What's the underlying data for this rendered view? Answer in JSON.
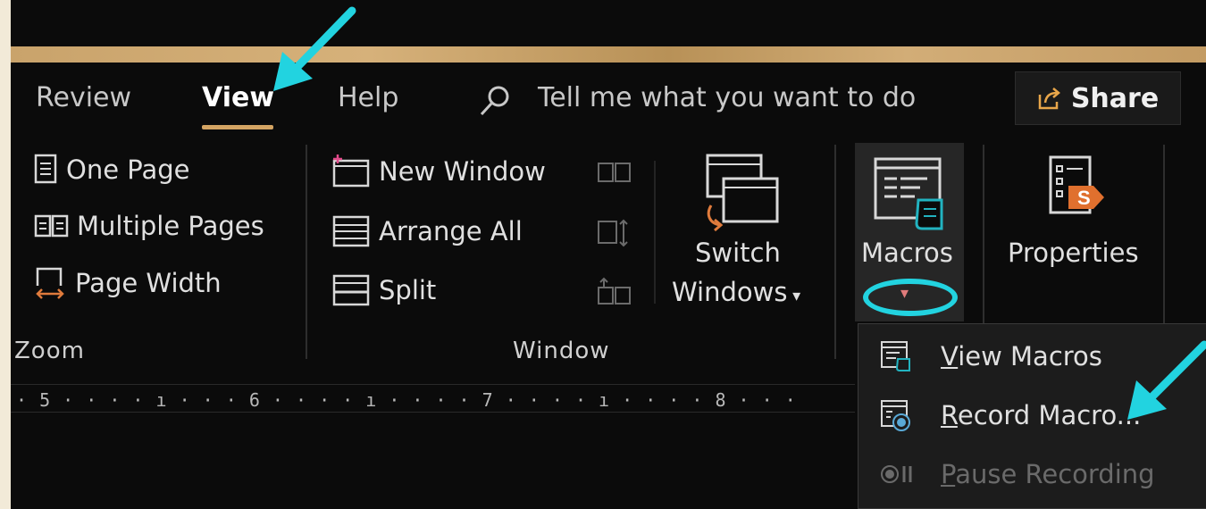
{
  "tabs": [
    {
      "label": "Review"
    },
    {
      "label": "View"
    },
    {
      "label": "Help"
    }
  ],
  "search": {
    "text": "Tell me what you want to do",
    "icon": "search-icon"
  },
  "share": {
    "label": "Share",
    "icon": "share-icon"
  },
  "zoom_group": {
    "items": [
      {
        "label": "One Page",
        "icon": "one-page-icon"
      },
      {
        "label": "Multiple Pages",
        "icon": "multiple-pages-icon"
      },
      {
        "label": "Page Width",
        "icon": "page-width-icon"
      }
    ],
    "group_label": "Zoom"
  },
  "window_group": {
    "items": [
      {
        "label": "New Window",
        "icon": "new-window-icon"
      },
      {
        "label": "Arrange All",
        "icon": "arrange-all-icon"
      },
      {
        "label": "Split",
        "icon": "split-icon"
      }
    ],
    "switch_windows": {
      "line1": "Switch",
      "line2": "Windows"
    },
    "group_label": "Window"
  },
  "macros": {
    "label": "Macros",
    "dropdown_caret": "▾"
  },
  "properties": {
    "label": "Properties"
  },
  "ruler": {
    "text": "· 5 · · · · ı · · · 6 · · · · ı · · · · 7 · · · · ı · · · · 8 · · ·"
  },
  "macros_menu": {
    "view_macros": {
      "accel": "V",
      "rest": "iew Macros"
    },
    "record_macro": {
      "accel": "R",
      "rest": "ecord Macro..."
    },
    "pause_recording": {
      "accel": "P",
      "rest": "ause Recording",
      "disabled": true
    }
  },
  "colors": {
    "accent_tab": "#d4a463",
    "annotation": "#22d3e0",
    "background": "#0b0b0b"
  }
}
